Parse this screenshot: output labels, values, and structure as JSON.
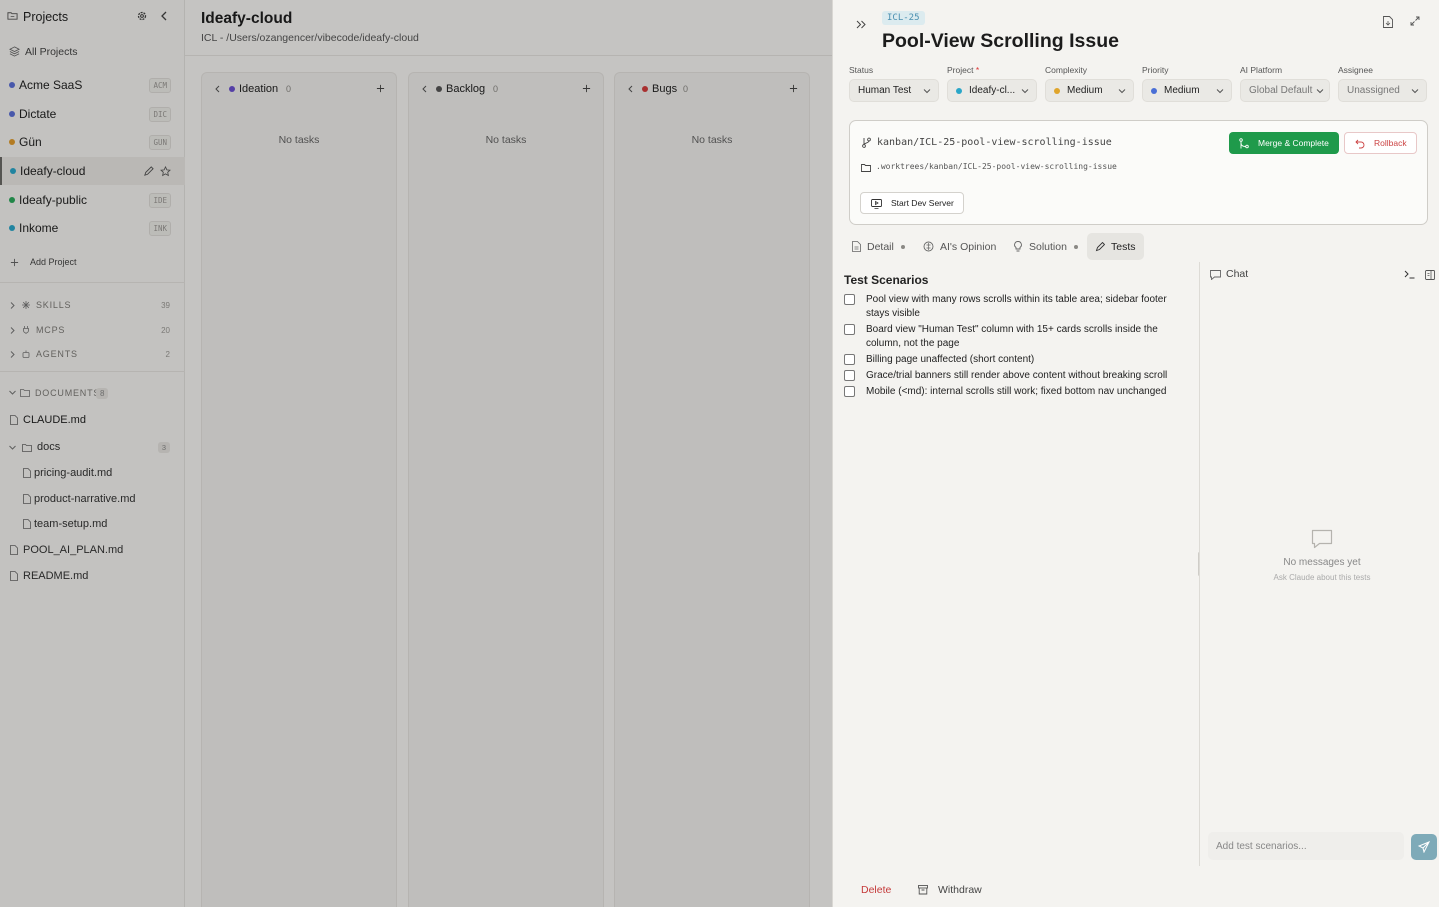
{
  "sidebar": {
    "title": "Projects",
    "all_projects": "All Projects",
    "projects": [
      {
        "name": "Acme SaaS",
        "abbr": "ACM",
        "color": "#5a6fd6"
      },
      {
        "name": "Dictate",
        "abbr": "DIC",
        "color": "#5a6fd6"
      },
      {
        "name": "Gün",
        "abbr": "GUN",
        "color": "#e09a2b"
      },
      {
        "name": "Ideafy-cloud",
        "abbr": "",
        "color": "#2aa6c8"
      },
      {
        "name": "Ideafy-public",
        "abbr": "IDE",
        "color": "#2aa85a"
      },
      {
        "name": "Inkome",
        "abbr": "INK",
        "color": "#2aa6c8"
      }
    ],
    "add_project": "Add Project",
    "skills": {
      "label": "SKILLS",
      "count": "39"
    },
    "mcps": {
      "label": "MCPS",
      "count": "20"
    },
    "agents": {
      "label": "AGENTS",
      "count": "2"
    },
    "documents": {
      "label": "DOCUMENTS",
      "count": "8"
    },
    "files": {
      "claude": "CLAUDE.md",
      "docs_folder": "docs",
      "docs_count": "3",
      "doc1": "pricing-audit.md",
      "doc2": "product-narrative.md",
      "doc3": "team-setup.md",
      "pool_plan": "POOL_AI_PLAN.md",
      "readme": "README.md"
    }
  },
  "board": {
    "title": "Ideafy-cloud",
    "path": "ICL - /Users/ozangencer/vibecode/ideafy-cloud",
    "columns": [
      {
        "name": "Ideation",
        "count": "0",
        "color": "#6a4fd0",
        "empty": "No tasks"
      },
      {
        "name": "Backlog",
        "count": "0",
        "color": "#555555",
        "empty": "No tasks"
      },
      {
        "name": "Bugs",
        "count": "0",
        "color": "#d33c3c",
        "empty": "No tasks"
      }
    ]
  },
  "ticket": {
    "id": "ICL-25",
    "title": "Pool-View Scrolling Issue",
    "fields": {
      "status": {
        "label": "Status",
        "value": "Human Test"
      },
      "project": {
        "label": "Project",
        "required": "*",
        "value": "Ideafy-cl...",
        "color": "#2aa6c8"
      },
      "complexity": {
        "label": "Complexity",
        "value": "Medium",
        "color": "#e0a52b"
      },
      "priority": {
        "label": "Priority",
        "value": "Medium",
        "color": "#4a6fd6"
      },
      "ai_platform": {
        "label": "AI Platform",
        "value": "Global Default"
      },
      "assignee": {
        "label": "Assignee",
        "value": "Unassigned"
      }
    },
    "git": {
      "branch": "kanban/ICL-25-pool-view-scrolling-issue",
      "worktree": ".worktrees/kanban/ICL-25-pool-view-scrolling-issue",
      "merge_label": "Merge & Complete",
      "rollback_label": "Rollback",
      "dev_server_label": "Start Dev Server"
    },
    "tabs": {
      "detail": "Detail",
      "opinion": "AI's Opinion",
      "solution": "Solution",
      "tests": "Tests"
    },
    "tests": {
      "title": "Test Scenarios",
      "items": [
        "Pool view with many rows scrolls within its table area; sidebar footer stays visible",
        "Board view \"Human Test\" column with 15+ cards scrolls inside the column, not the page",
        "Billing page unaffected (short content)",
        "Grace/trial banners still render above content without breaking scroll",
        "Mobile (<md): internal scrolls still work; fixed bottom nav unchanged"
      ]
    },
    "chat": {
      "title": "Chat",
      "empty": "No messages yet",
      "empty_sub": "Ask Claude about this tests",
      "placeholder": "Add test scenarios..."
    },
    "footer": {
      "delete": "Delete",
      "withdraw": "Withdraw"
    }
  }
}
